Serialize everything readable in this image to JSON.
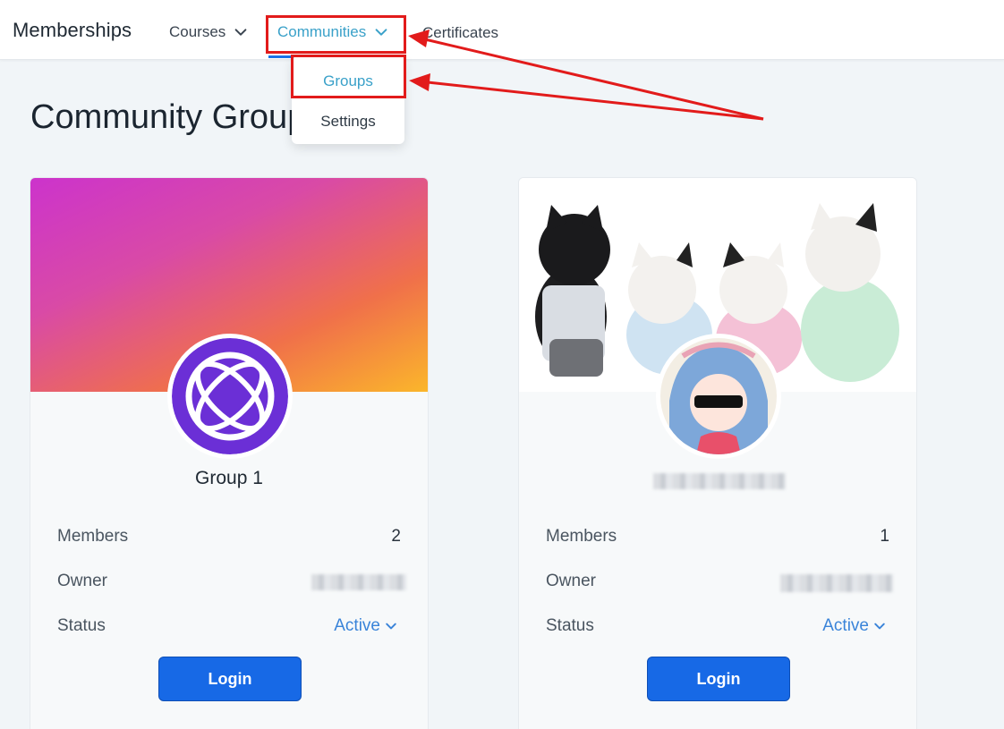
{
  "nav": {
    "brand": "Memberships",
    "courses": "Courses",
    "communities": "Communities",
    "certificates": "Certificates"
  },
  "dropdown": {
    "groups": "Groups",
    "settings": "Settings"
  },
  "page": {
    "title": "Community Groups"
  },
  "cards": [
    {
      "name": "Group 1",
      "members_label": "Members",
      "members_value": "2",
      "owner_label": "Owner",
      "status_label": "Status",
      "status_value": "Active",
      "login_label": "Login",
      "avatar_icon": "orbit-logo-icon",
      "cover": "gradient-cover"
    },
    {
      "name": "",
      "members_label": "Members",
      "members_value": "1",
      "owner_label": "Owner",
      "status_label": "Status",
      "status_value": "Active",
      "login_label": "Login",
      "avatar_icon": "chibi-character-avatar",
      "cover": "plush-cats-photo"
    }
  ],
  "colors": {
    "accent": "#3aa1c9",
    "button": "#1769e6",
    "annotation": "#e21b1b",
    "status": "#3a84d9"
  }
}
